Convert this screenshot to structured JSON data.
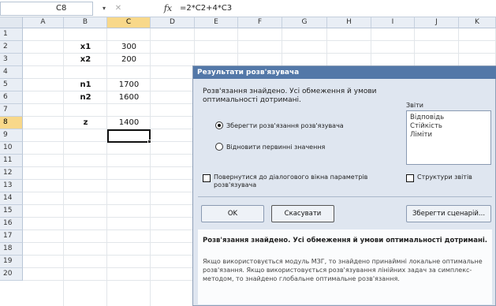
{
  "formula_bar": {
    "cell_ref": "C8",
    "dropdown_glyph": "▾",
    "cancel_glyph": "✕",
    "fx_label": "fx",
    "formula": "=2*C2+4*C3"
  },
  "grid": {
    "columns": [
      "A",
      "B",
      "C",
      "D",
      "E",
      "F",
      "G",
      "H",
      "I",
      "J",
      "K"
    ],
    "rows": [
      "1",
      "2",
      "3",
      "4",
      "5",
      "6",
      "7",
      "8",
      "9",
      "10",
      "11",
      "12",
      "13",
      "14",
      "15",
      "16",
      "17",
      "18",
      "19",
      "20"
    ],
    "selected_column": "C",
    "selected_row": "8",
    "cells": {
      "B2": "x1",
      "C2": "300",
      "B3": "x2",
      "C3": "200",
      "B5": "n1",
      "C5": "1700",
      "B6": "n2",
      "C6": "1600",
      "B8": "z",
      "C8": "1400"
    }
  },
  "dialog": {
    "title": "Результати розв'язувача",
    "message": "Розв'язання знайдено. Усі обмеження й умови оптимальності дотримані.",
    "radio_keep": "Зберегти розв'язання розв'язувача",
    "radio_restore": "Відновити первинні значення",
    "reports_label": "Звіти",
    "reports": [
      "Відповідь",
      "Стійкість",
      "Ліміти"
    ],
    "checkbox_return": "Повернутися до діалогового вікна параметрів розв'язувача",
    "checkbox_outline": "Структури звітів",
    "btn_ok": "OK",
    "btn_cancel": "Скасувати",
    "btn_save_scenario": "Зберегти сценарій...",
    "info_bold": "Розв'язання знайдено. Усі обмеження й умови оптимальності дотримані.",
    "info_text": "Якщо використовується модуль МЗГ, то знайдено принаймні локальне оптимальне розв'язання. Якщо використовується розв'язування лінійних задач за симплекс-методом, то знайдено глобальне оптимальне розв'язання."
  }
}
